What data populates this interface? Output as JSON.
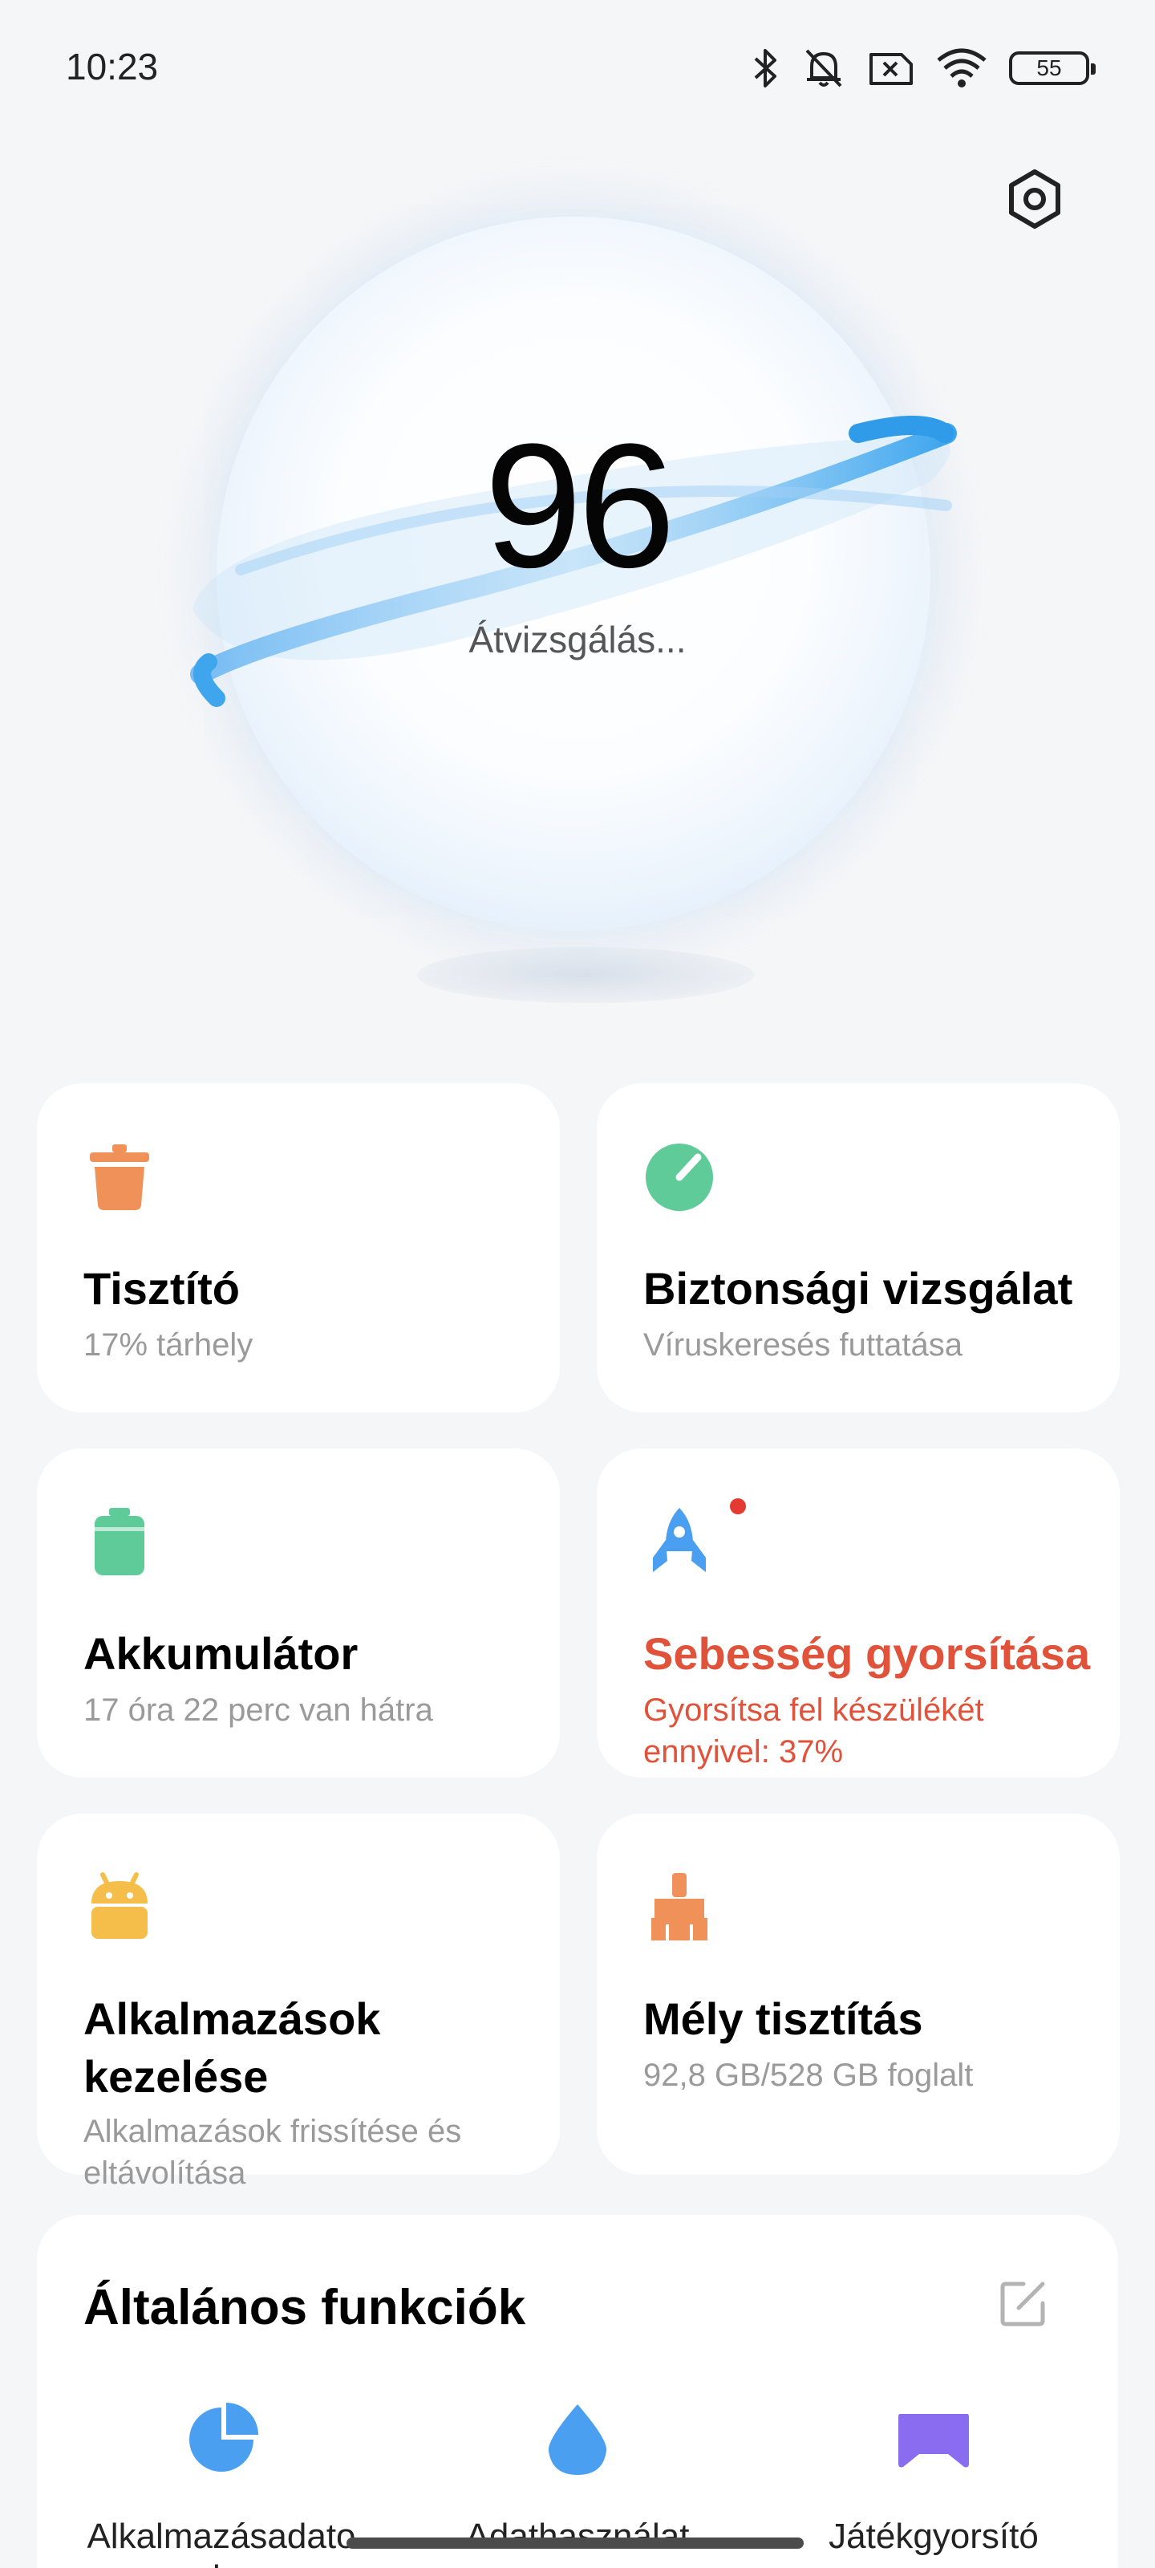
{
  "status_bar": {
    "time": "10:23",
    "battery": "55"
  },
  "hero": {
    "score": "96",
    "status": "Átvizsgálás..."
  },
  "cards": [
    {
      "title": "Tisztító",
      "subtitle": "17% tárhely",
      "icon": "trash-icon",
      "color": "#f0915a"
    },
    {
      "title": "Biztonsági vizsgálat",
      "subtitle": "Víruskeresés futtatása",
      "icon": "shield-gauge-icon",
      "color": "#5fcb98"
    },
    {
      "title": "Akkumulátor",
      "subtitle": "17 óra 22 perc  van hátra",
      "icon": "battery-icon",
      "color": "#5fcb98"
    },
    {
      "title": "Sebesség gyorsítása",
      "subtitle": "Gyorsítsa fel készülékét ennyivel: 37%",
      "icon": "rocket-icon",
      "color": "#4a9ff0",
      "alert_color": "#e0523a"
    },
    {
      "title": "Alkalmazások kezelése",
      "subtitle": "Alkalmazások frissítése és eltávolítása",
      "icon": "android-icon",
      "color": "#f5be4a"
    },
    {
      "title": "Mély tisztítás",
      "subtitle": "92,8 GB/528 GB foglalt",
      "icon": "brush-icon",
      "color": "#f0915a"
    }
  ],
  "functions": {
    "title": "Általános funkciók",
    "items": [
      {
        "label": "Alkalmazásadatok",
        "icon": "pie-chart-icon",
        "color": "#4a9ff0"
      },
      {
        "label": "Adathasználat",
        "icon": "drop-icon",
        "color": "#4a9ff0"
      },
      {
        "label": "Játékgyorsító",
        "icon": "gamepad-icon",
        "color": "#8a6cf0"
      }
    ]
  }
}
